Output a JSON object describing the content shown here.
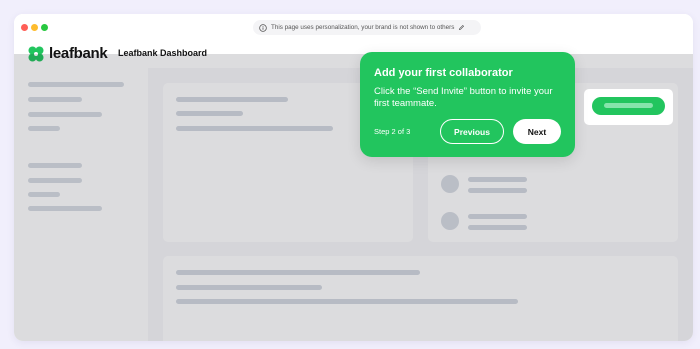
{
  "browser": {
    "url_notice": "This page uses personalization, your brand is not shown to others",
    "info_icon": "info-icon",
    "edit_icon": "pencil-icon"
  },
  "app": {
    "brand": "leafbank",
    "title": "Leafbank Dashboard",
    "logo_icon": "clover-logo-icon"
  },
  "tour": {
    "title": "Add your first collaborator",
    "body": "Click the “Send Invite” button to invite your first teammate.",
    "step": "Step 2 of 3",
    "previous_label": "Previous",
    "next_label": "Next"
  },
  "colors": {
    "accent": "#22c55e",
    "overlay": "#282832",
    "placeholder": "#d3d8e0"
  }
}
